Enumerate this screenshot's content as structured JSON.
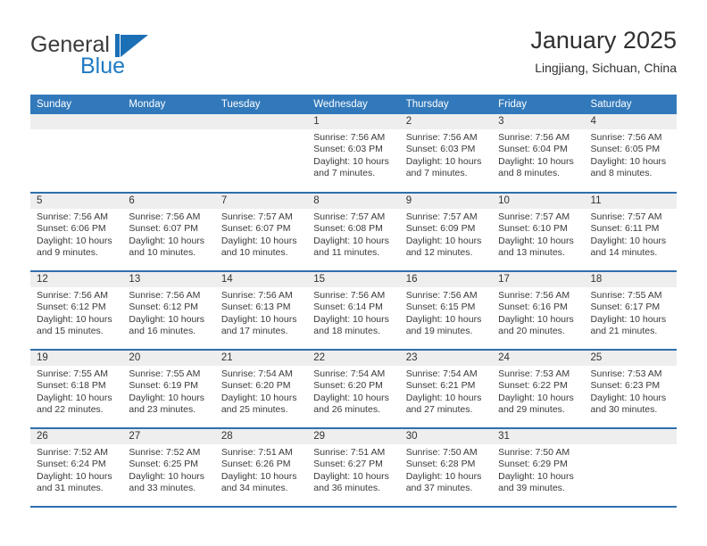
{
  "brand": {
    "name_part1": "General",
    "name_part2": "Blue",
    "mark": "triangle-flag-logo"
  },
  "header": {
    "title": "January 2025",
    "subtitle": "Lingjiang, Sichuan, China"
  },
  "colors": {
    "header_blue": "#3279bb",
    "row_border_blue": "#2f6fae",
    "daynum_band": "#eeeeee",
    "brand_blue": "#1f7ac4",
    "text": "#3a3a3a"
  },
  "weekdays": [
    "Sunday",
    "Monday",
    "Tuesday",
    "Wednesday",
    "Thursday",
    "Friday",
    "Saturday"
  ],
  "weeks": [
    [
      {
        "day": "",
        "sunrise": "",
        "sunset": "",
        "daylight": "",
        "blank": true
      },
      {
        "day": "",
        "sunrise": "",
        "sunset": "",
        "daylight": "",
        "blank": true
      },
      {
        "day": "",
        "sunrise": "",
        "sunset": "",
        "daylight": "",
        "blank": true
      },
      {
        "day": "1",
        "sunrise": "Sunrise: 7:56 AM",
        "sunset": "Sunset: 6:03 PM",
        "daylight": "Daylight: 10 hours and 7 minutes."
      },
      {
        "day": "2",
        "sunrise": "Sunrise: 7:56 AM",
        "sunset": "Sunset: 6:03 PM",
        "daylight": "Daylight: 10 hours and 7 minutes."
      },
      {
        "day": "3",
        "sunrise": "Sunrise: 7:56 AM",
        "sunset": "Sunset: 6:04 PM",
        "daylight": "Daylight: 10 hours and 8 minutes."
      },
      {
        "day": "4",
        "sunrise": "Sunrise: 7:56 AM",
        "sunset": "Sunset: 6:05 PM",
        "daylight": "Daylight: 10 hours and 8 minutes."
      }
    ],
    [
      {
        "day": "5",
        "sunrise": "Sunrise: 7:56 AM",
        "sunset": "Sunset: 6:06 PM",
        "daylight": "Daylight: 10 hours and 9 minutes."
      },
      {
        "day": "6",
        "sunrise": "Sunrise: 7:56 AM",
        "sunset": "Sunset: 6:07 PM",
        "daylight": "Daylight: 10 hours and 10 minutes."
      },
      {
        "day": "7",
        "sunrise": "Sunrise: 7:57 AM",
        "sunset": "Sunset: 6:07 PM",
        "daylight": "Daylight: 10 hours and 10 minutes."
      },
      {
        "day": "8",
        "sunrise": "Sunrise: 7:57 AM",
        "sunset": "Sunset: 6:08 PM",
        "daylight": "Daylight: 10 hours and 11 minutes."
      },
      {
        "day": "9",
        "sunrise": "Sunrise: 7:57 AM",
        "sunset": "Sunset: 6:09 PM",
        "daylight": "Daylight: 10 hours and 12 minutes."
      },
      {
        "day": "10",
        "sunrise": "Sunrise: 7:57 AM",
        "sunset": "Sunset: 6:10 PM",
        "daylight": "Daylight: 10 hours and 13 minutes."
      },
      {
        "day": "11",
        "sunrise": "Sunrise: 7:57 AM",
        "sunset": "Sunset: 6:11 PM",
        "daylight": "Daylight: 10 hours and 14 minutes."
      }
    ],
    [
      {
        "day": "12",
        "sunrise": "Sunrise: 7:56 AM",
        "sunset": "Sunset: 6:12 PM",
        "daylight": "Daylight: 10 hours and 15 minutes."
      },
      {
        "day": "13",
        "sunrise": "Sunrise: 7:56 AM",
        "sunset": "Sunset: 6:12 PM",
        "daylight": "Daylight: 10 hours and 16 minutes."
      },
      {
        "day": "14",
        "sunrise": "Sunrise: 7:56 AM",
        "sunset": "Sunset: 6:13 PM",
        "daylight": "Daylight: 10 hours and 17 minutes."
      },
      {
        "day": "15",
        "sunrise": "Sunrise: 7:56 AM",
        "sunset": "Sunset: 6:14 PM",
        "daylight": "Daylight: 10 hours and 18 minutes."
      },
      {
        "day": "16",
        "sunrise": "Sunrise: 7:56 AM",
        "sunset": "Sunset: 6:15 PM",
        "daylight": "Daylight: 10 hours and 19 minutes."
      },
      {
        "day": "17",
        "sunrise": "Sunrise: 7:56 AM",
        "sunset": "Sunset: 6:16 PM",
        "daylight": "Daylight: 10 hours and 20 minutes."
      },
      {
        "day": "18",
        "sunrise": "Sunrise: 7:55 AM",
        "sunset": "Sunset: 6:17 PM",
        "daylight": "Daylight: 10 hours and 21 minutes."
      }
    ],
    [
      {
        "day": "19",
        "sunrise": "Sunrise: 7:55 AM",
        "sunset": "Sunset: 6:18 PM",
        "daylight": "Daylight: 10 hours and 22 minutes."
      },
      {
        "day": "20",
        "sunrise": "Sunrise: 7:55 AM",
        "sunset": "Sunset: 6:19 PM",
        "daylight": "Daylight: 10 hours and 23 minutes."
      },
      {
        "day": "21",
        "sunrise": "Sunrise: 7:54 AM",
        "sunset": "Sunset: 6:20 PM",
        "daylight": "Daylight: 10 hours and 25 minutes."
      },
      {
        "day": "22",
        "sunrise": "Sunrise: 7:54 AM",
        "sunset": "Sunset: 6:20 PM",
        "daylight": "Daylight: 10 hours and 26 minutes."
      },
      {
        "day": "23",
        "sunrise": "Sunrise: 7:54 AM",
        "sunset": "Sunset: 6:21 PM",
        "daylight": "Daylight: 10 hours and 27 minutes."
      },
      {
        "day": "24",
        "sunrise": "Sunrise: 7:53 AM",
        "sunset": "Sunset: 6:22 PM",
        "daylight": "Daylight: 10 hours and 29 minutes."
      },
      {
        "day": "25",
        "sunrise": "Sunrise: 7:53 AM",
        "sunset": "Sunset: 6:23 PM",
        "daylight": "Daylight: 10 hours and 30 minutes."
      }
    ],
    [
      {
        "day": "26",
        "sunrise": "Sunrise: 7:52 AM",
        "sunset": "Sunset: 6:24 PM",
        "daylight": "Daylight: 10 hours and 31 minutes."
      },
      {
        "day": "27",
        "sunrise": "Sunrise: 7:52 AM",
        "sunset": "Sunset: 6:25 PM",
        "daylight": "Daylight: 10 hours and 33 minutes."
      },
      {
        "day": "28",
        "sunrise": "Sunrise: 7:51 AM",
        "sunset": "Sunset: 6:26 PM",
        "daylight": "Daylight: 10 hours and 34 minutes."
      },
      {
        "day": "29",
        "sunrise": "Sunrise: 7:51 AM",
        "sunset": "Sunset: 6:27 PM",
        "daylight": "Daylight: 10 hours and 36 minutes."
      },
      {
        "day": "30",
        "sunrise": "Sunrise: 7:50 AM",
        "sunset": "Sunset: 6:28 PM",
        "daylight": "Daylight: 10 hours and 37 minutes."
      },
      {
        "day": "31",
        "sunrise": "Sunrise: 7:50 AM",
        "sunset": "Sunset: 6:29 PM",
        "daylight": "Daylight: 10 hours and 39 minutes."
      },
      {
        "day": "",
        "sunrise": "",
        "sunset": "",
        "daylight": "",
        "blank": true
      }
    ]
  ]
}
